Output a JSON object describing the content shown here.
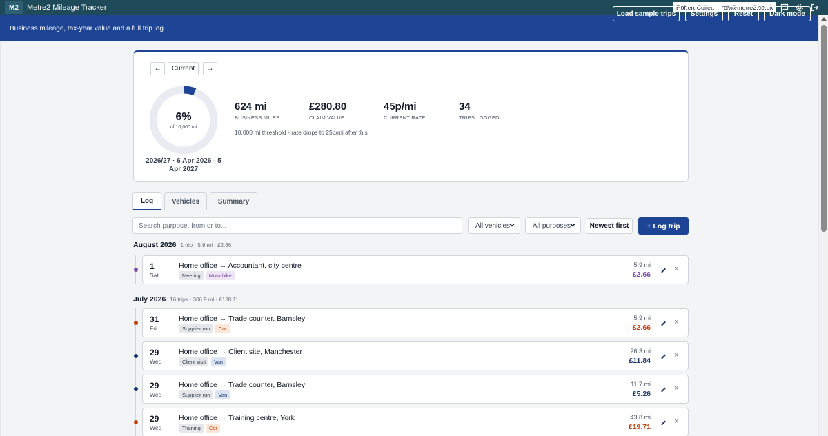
{
  "app": {
    "logo": "M2",
    "title": "Metre2 Mileage Tracker"
  },
  "account": {
    "name": "Robert Collett",
    "email": "rob@metre2.co.uk"
  },
  "titlebar_icons": [
    "chat-icon",
    "gear-icon",
    "logout-icon"
  ],
  "banner": {
    "text": "Business mileage, tax-year value and a full trip log",
    "buttons": [
      "Load sample trips",
      "Settings",
      "Reset",
      "Dark mode"
    ]
  },
  "summary": {
    "nav": {
      "prev": "←",
      "current": "Current",
      "next": "→"
    },
    "progress_percent": 6,
    "ring_label": "6%",
    "ring_sub": "of 10,000 mi",
    "tax_year": "2026/27 · 6 Apr 2026 - 5 Apr 2027",
    "stats": [
      {
        "value": "624 mi",
        "label": "BUSINESS MILES"
      },
      {
        "value": "£280.80",
        "label": "CLAIM VALUE"
      },
      {
        "value": "45p/mi",
        "label": "CURRENT RATE"
      },
      {
        "value": "34",
        "label": "TRIPS LOGGED"
      }
    ],
    "threshold_note": "10,000 mi threshold - rate drops to 25p/mi after this"
  },
  "tabs": [
    "Log",
    "Vehicles",
    "Summary"
  ],
  "filters": {
    "search_placeholder": "Search purpose, from or to...",
    "vehicle": "All vehicles",
    "purpose": "All purposes",
    "sort": "Newest first",
    "log_trip": "+ Log trip"
  },
  "colors": {
    "brand": "#1e4595",
    "motorbike": "#7c4ba8",
    "car": "#c2410c",
    "van": "#1e3a6e"
  },
  "groups": [
    {
      "title": "August 2026",
      "meta": "1 trip · 5.9 mi · £2.66",
      "trips": [
        {
          "day": "1",
          "dow": "Sat",
          "route": "Home office → Accountant, city centre",
          "purpose": "Meeting",
          "vehicle": "Motorbike",
          "miles": "5.9 mi",
          "amount": "£2.66",
          "kind": "motorbike"
        }
      ]
    },
    {
      "title": "July 2026",
      "meta": "16 trips · 306.9 mi · £138.11",
      "trips": [
        {
          "day": "31",
          "dow": "Fri",
          "route": "Home office → Trade counter, Barnsley",
          "purpose": "Supplier run",
          "vehicle": "Car",
          "miles": "5.9 mi",
          "amount": "£2.66",
          "kind": "car"
        },
        {
          "day": "29",
          "dow": "Wed",
          "route": "Home office → Client site, Manchester",
          "purpose": "Client visit",
          "vehicle": "Van",
          "miles": "26.3 mi",
          "amount": "£11.84",
          "kind": "van"
        },
        {
          "day": "29",
          "dow": "Wed",
          "route": "Home office → Trade counter, Barnsley",
          "purpose": "Supplier run",
          "vehicle": "Van",
          "miles": "11.7 mi",
          "amount": "£5.26",
          "kind": "van"
        },
        {
          "day": "29",
          "dow": "Wed",
          "route": "Home office → Training centre, York",
          "purpose": "Training",
          "vehicle": "Car",
          "miles": "43.8 mi",
          "amount": "£19.71",
          "kind": "car"
        }
      ]
    }
  ]
}
